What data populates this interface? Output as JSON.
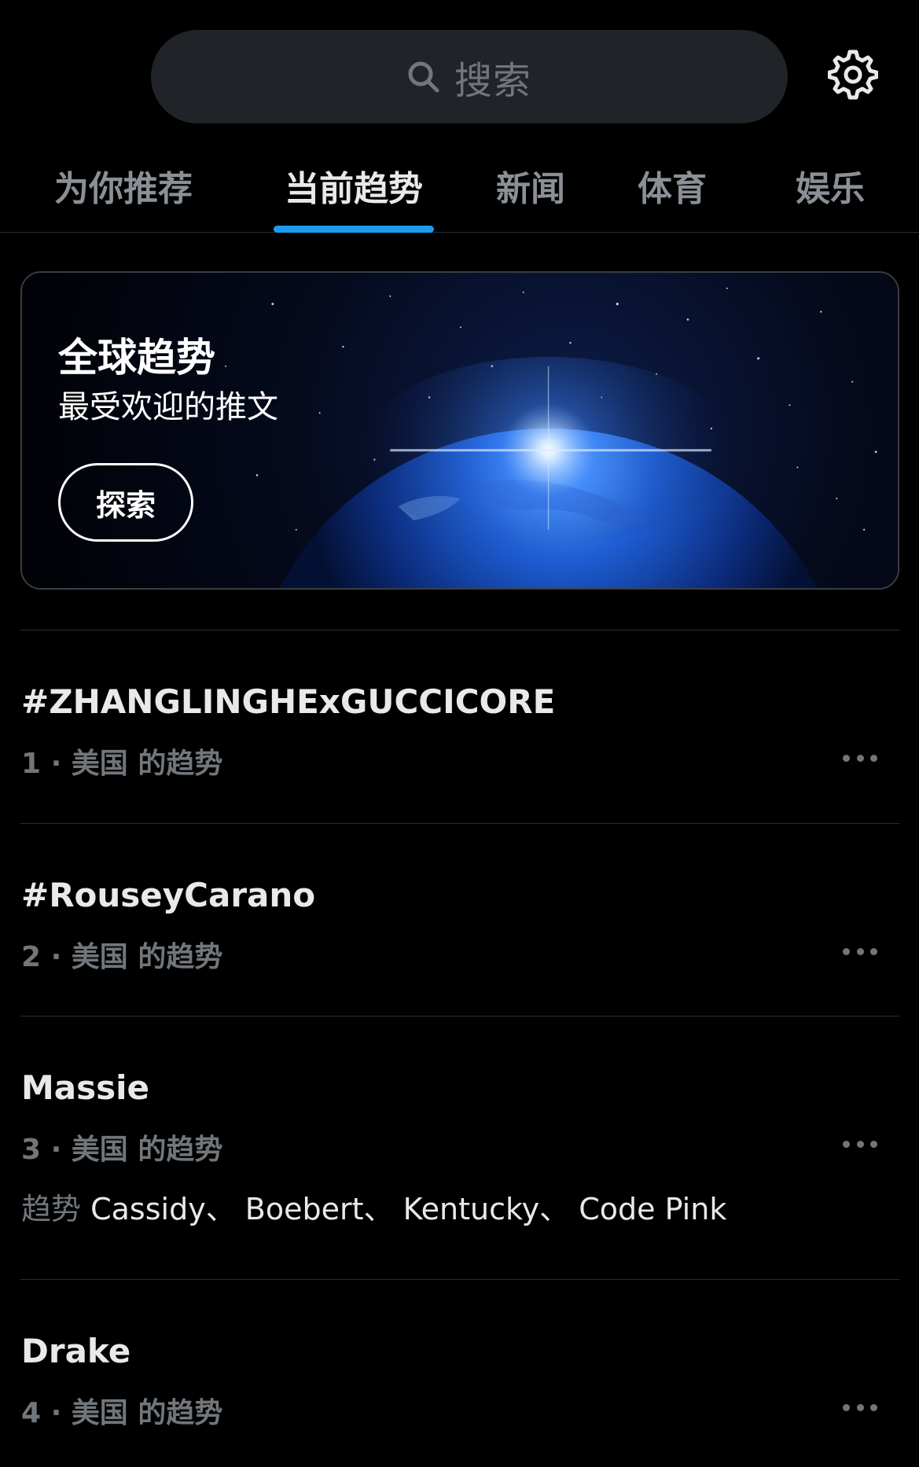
{
  "search": {
    "placeholder": "搜索",
    "icon": "search-icon"
  },
  "settings": {
    "icon": "gear-icon"
  },
  "tabs": [
    {
      "label": "为你推荐",
      "active": false
    },
    {
      "label": "当前趋势",
      "active": true
    },
    {
      "label": "新闻",
      "active": false
    },
    {
      "label": "体育",
      "active": false
    },
    {
      "label": "娱乐",
      "active": false
    }
  ],
  "banner": {
    "title": "全球趋势",
    "subtitle": "最受欢迎的推文",
    "button_label": "探索"
  },
  "trends": [
    {
      "name": "#ZHANGLINGHExGUCCICORE",
      "meta": "1 · 美国 的趋势"
    },
    {
      "name": "#RouseyCarano",
      "meta": "2 · 美国 的趋势"
    },
    {
      "name": "Massie",
      "meta": "3 · 美国 的趋势",
      "related_prefix": "趋势",
      "related": [
        "Cassidy、",
        "Boebert、",
        "Kentucky、",
        "Code Pink"
      ]
    },
    {
      "name": "Drake",
      "meta": "4 · 美国 的趋势"
    }
  ],
  "colors": {
    "background": "#000000",
    "accent": "#1d9bf0",
    "primary_text": "#e7e9ea",
    "secondary_text": "#71767b",
    "search_bg": "#202327"
  }
}
